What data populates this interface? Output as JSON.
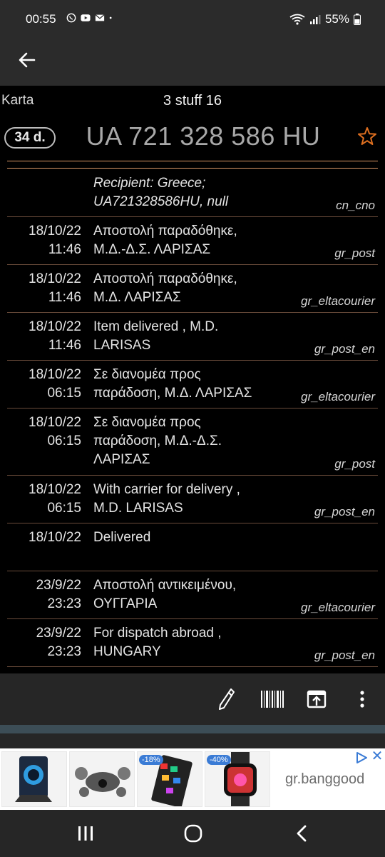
{
  "status_bar": {
    "time": "00:55",
    "notification_icons": [
      "viber-icon",
      "youtube-icon",
      "mail-icon",
      "dot-icon"
    ],
    "battery": "55%"
  },
  "header": {
    "left_label": "Karta",
    "center_title": "3 stuff 16"
  },
  "parcel": {
    "days_badge": "34 d.",
    "tracking_number": "UA 721 328 586 HU",
    "star_color": "#e07020"
  },
  "events": [
    {
      "date": "",
      "time": "",
      "desc_line1": "Recipient: Greece;",
      "desc_line2": "UA721328586HU, null",
      "desc_line3": "",
      "source": "cn_cno",
      "italic": true
    },
    {
      "date": "18/10/22",
      "time": "11:46",
      "desc_line1": "Αποστολή παραδόθηκε,",
      "desc_line2": "Μ.Δ.-Δ.Σ. ΛΑΡΙΣΑΣ",
      "desc_line3": "",
      "source": "gr_post",
      "italic": false
    },
    {
      "date": "18/10/22",
      "time": "11:46",
      "desc_line1": "Αποστολή παραδόθηκε,",
      "desc_line2": "Μ.Δ. ΛΑΡΙΣΑΣ",
      "desc_line3": "",
      "source": "gr_eltacourier",
      "italic": false
    },
    {
      "date": "18/10/22",
      "time": "11:46",
      "desc_line1": "Item delivered , M.D.",
      "desc_line2": "LARISAS",
      "desc_line3": "",
      "source": "gr_post_en",
      "italic": false
    },
    {
      "date": "18/10/22",
      "time": "06:15",
      "desc_line1": "Σε διανομέα προς",
      "desc_line2": "παράδοση, Μ.Δ. ΛΑΡΙΣΑΣ",
      "desc_line3": "",
      "source": "gr_eltacourier",
      "italic": false
    },
    {
      "date": "18/10/22",
      "time": "06:15",
      "desc_line1": "Σε διανομέα προς",
      "desc_line2": "παράδοση, Μ.Δ.-Δ.Σ.",
      "desc_line3": "ΛΑΡΙΣΑΣ",
      "source": "gr_post",
      "italic": false
    },
    {
      "date": "18/10/22",
      "time": "06:15",
      "desc_line1": "With carrier for delivery ,",
      "desc_line2": "M.D. LARISAS",
      "desc_line3": "",
      "source": "gr_post_en",
      "italic": false
    },
    {
      "date": "18/10/22",
      "time": "",
      "desc_line1": "Delivered",
      "desc_line2": "",
      "desc_line3": "",
      "source": "",
      "italic": false
    },
    {
      "date": "23/9/22",
      "time": "23:23",
      "desc_line1": "Αποστολή αντικειμένου,",
      "desc_line2": "ΟΥΓΓΑΡΙΑ",
      "desc_line3": "",
      "source": "gr_eltacourier",
      "italic": false
    },
    {
      "date": "23/9/22",
      "time": "23:23",
      "desc_line1": "For dispatch abroad ,",
      "desc_line2": "HUNGARY",
      "desc_line3": "",
      "source": "gr_post_en",
      "italic": false
    }
  ],
  "toolbar": {
    "icons": [
      "edit-icon",
      "barcode-icon",
      "share-icon",
      "more-vert-icon"
    ]
  },
  "ad": {
    "domain": "gr.banggood",
    "discount_1": "-18%",
    "discount_2": "-40%"
  },
  "nav": {
    "icons": [
      "recents-icon",
      "home-icon",
      "back-icon"
    ]
  }
}
